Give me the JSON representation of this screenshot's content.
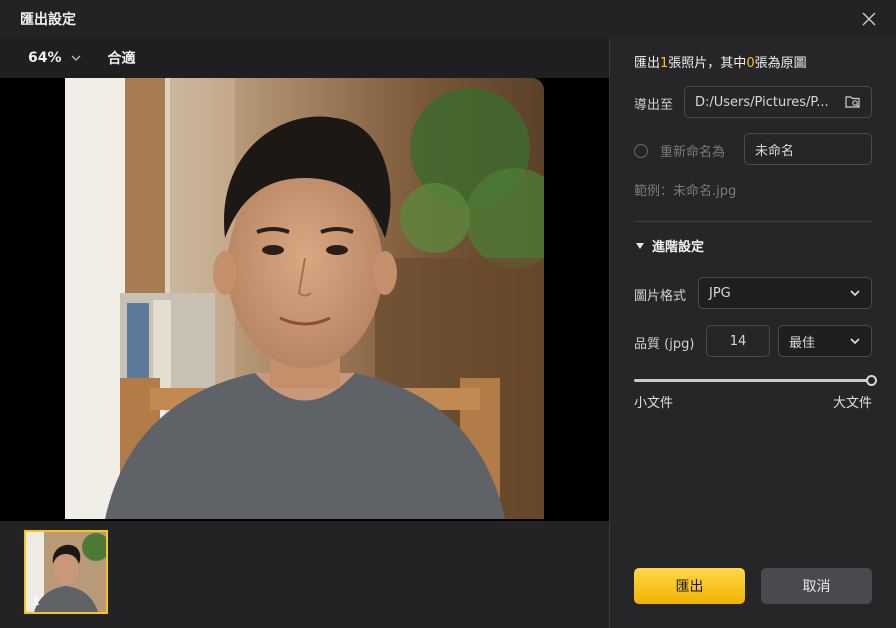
{
  "window": {
    "title": "匯出設定"
  },
  "toolbar": {
    "zoom": "64%",
    "fit_label": "合適"
  },
  "filmstrip": {
    "items": [
      {
        "index": "1"
      }
    ]
  },
  "panel": {
    "summary_prefix": "匯出",
    "summary_count": "1",
    "summary_mid": "張照片，其中",
    "summary_original": "0",
    "summary_suffix": "張為原圖",
    "export_to_label": "導出至",
    "export_path": "D:/Users/Pictures/P...",
    "rename_label": "重新命名為",
    "rename_value": "未命名",
    "example_text": "範例：未命名.jpg",
    "advanced_label": "進階設定",
    "format_label": "圖片格式",
    "format_value": "JPG",
    "quality_label": "品質 (jpg)",
    "quality_number": "14",
    "quality_preset": "最佳",
    "quality_level": 1.0,
    "slider_min_label": "小文件",
    "slider_max_label": "大文件",
    "export_button": "匯出",
    "cancel_button": "取消"
  },
  "colors": {
    "accent": "#f5c518"
  }
}
